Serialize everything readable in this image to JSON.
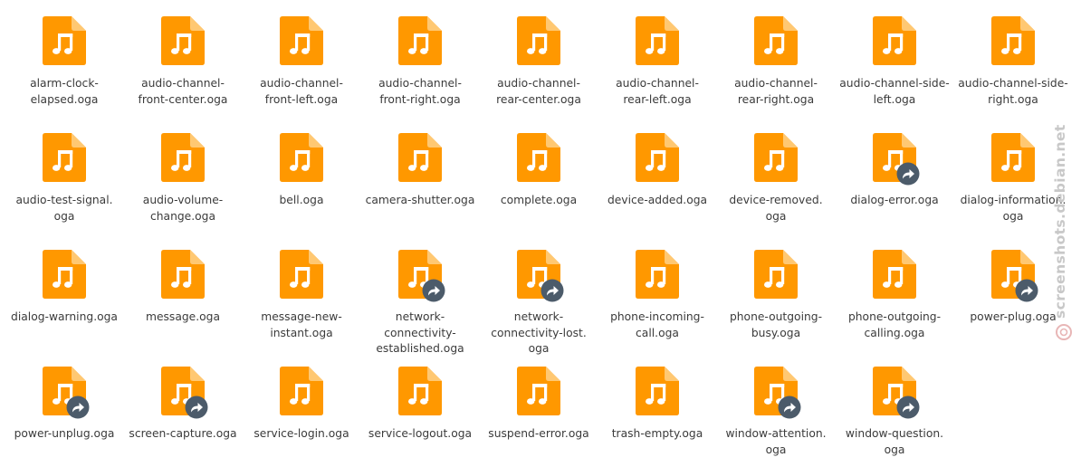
{
  "colors": {
    "file_body": "#ff9800",
    "file_fold": "#ffc872",
    "note_glyph": "#ffffff",
    "link_badge": "#4c5b6a",
    "label_text": "#3b3b3b",
    "watermark_text": "#c8c8c8",
    "watermark_logo": "#e8b6b6"
  },
  "watermark": {
    "text": "screenshots.debian.net",
    "logo_icon": "debian-swirl-icon"
  },
  "files": [
    {
      "name": "alarm-clock-elapsed.oga",
      "lines": [
        "alarm-clock-",
        "elapsed.oga"
      ],
      "icon": "audio-file-icon",
      "symlink": false
    },
    {
      "name": "audio-channel-front-center.oga",
      "lines": [
        "audio-channel-",
        "front-center.oga"
      ],
      "icon": "audio-file-icon",
      "symlink": false
    },
    {
      "name": "audio-channel-front-left.oga",
      "lines": [
        "audio-channel-",
        "front-left.oga"
      ],
      "icon": "audio-file-icon",
      "symlink": false
    },
    {
      "name": "audio-channel-front-right.oga",
      "lines": [
        "audio-channel-",
        "front-right.oga"
      ],
      "icon": "audio-file-icon",
      "symlink": false
    },
    {
      "name": "audio-channel-rear-center.oga",
      "lines": [
        "audio-channel-",
        "rear-center.oga"
      ],
      "icon": "audio-file-icon",
      "symlink": false
    },
    {
      "name": "audio-channel-rear-left.oga",
      "lines": [
        "audio-channel-",
        "rear-left.oga"
      ],
      "icon": "audio-file-icon",
      "symlink": false
    },
    {
      "name": "audio-channel-rear-right.oga",
      "lines": [
        "audio-channel-",
        "rear-right.oga"
      ],
      "icon": "audio-file-icon",
      "symlink": false
    },
    {
      "name": "audio-channel-side-left.oga",
      "lines": [
        "audio-channel-side-",
        "left.oga"
      ],
      "icon": "audio-file-icon",
      "symlink": false
    },
    {
      "name": "audio-channel-side-right.oga",
      "lines": [
        "audio-channel-side-",
        "right.oga"
      ],
      "icon": "audio-file-icon",
      "symlink": false
    },
    {
      "name": "audio-test-signal.oga",
      "lines": [
        "audio-test-signal.",
        "oga"
      ],
      "icon": "audio-file-icon",
      "symlink": false
    },
    {
      "name": "audio-volume-change.oga",
      "lines": [
        "audio-volume-",
        "change.oga"
      ],
      "icon": "audio-file-icon",
      "symlink": false
    },
    {
      "name": "bell.oga",
      "lines": [
        "bell.oga"
      ],
      "icon": "audio-file-icon",
      "symlink": false
    },
    {
      "name": "camera-shutter.oga",
      "lines": [
        "camera-shutter.oga"
      ],
      "icon": "audio-file-icon",
      "symlink": false
    },
    {
      "name": "complete.oga",
      "lines": [
        "complete.oga"
      ],
      "icon": "audio-file-icon",
      "symlink": false
    },
    {
      "name": "device-added.oga",
      "lines": [
        "device-added.oga"
      ],
      "icon": "audio-file-icon",
      "symlink": false
    },
    {
      "name": "device-removed.oga",
      "lines": [
        "device-removed.",
        "oga"
      ],
      "icon": "audio-file-icon",
      "symlink": false
    },
    {
      "name": "dialog-error.oga",
      "lines": [
        "dialog-error.oga"
      ],
      "icon": "audio-file-icon",
      "symlink": true
    },
    {
      "name": "dialog-information.oga",
      "lines": [
        "dialog-information.",
        "oga"
      ],
      "icon": "audio-file-icon",
      "symlink": false
    },
    {
      "name": "dialog-warning.oga",
      "lines": [
        "dialog-warning.oga"
      ],
      "icon": "audio-file-icon",
      "symlink": false
    },
    {
      "name": "message.oga",
      "lines": [
        "message.oga"
      ],
      "icon": "audio-file-icon",
      "symlink": false
    },
    {
      "name": "message-new-instant.oga",
      "lines": [
        "message-new-",
        "instant.oga"
      ],
      "icon": "audio-file-icon",
      "symlink": false
    },
    {
      "name": "network-connectivity-established.oga",
      "lines": [
        "network-",
        "connectivity-",
        "established.oga"
      ],
      "icon": "audio-file-icon",
      "symlink": true
    },
    {
      "name": "network-connectivity-lost.oga",
      "lines": [
        "network-",
        "connectivity-lost.",
        "oga"
      ],
      "icon": "audio-file-icon",
      "symlink": true
    },
    {
      "name": "phone-incoming-call.oga",
      "lines": [
        "phone-incoming-",
        "call.oga"
      ],
      "icon": "audio-file-icon",
      "symlink": false
    },
    {
      "name": "phone-outgoing-busy.oga",
      "lines": [
        "phone-outgoing-",
        "busy.oga"
      ],
      "icon": "audio-file-icon",
      "symlink": false
    },
    {
      "name": "phone-outgoing-calling.oga",
      "lines": [
        "phone-outgoing-",
        "calling.oga"
      ],
      "icon": "audio-file-icon",
      "symlink": false
    },
    {
      "name": "power-plug.oga",
      "lines": [
        "power-plug.oga"
      ],
      "icon": "audio-file-icon",
      "symlink": true
    },
    {
      "name": "power-unplug.oga",
      "lines": [
        "power-unplug.oga"
      ],
      "icon": "audio-file-icon",
      "symlink": true
    },
    {
      "name": "screen-capture.oga",
      "lines": [
        "screen-capture.oga"
      ],
      "icon": "audio-file-icon",
      "symlink": true
    },
    {
      "name": "service-login.oga",
      "lines": [
        "service-login.oga"
      ],
      "icon": "audio-file-icon",
      "symlink": false
    },
    {
      "name": "service-logout.oga",
      "lines": [
        "service-logout.oga"
      ],
      "icon": "audio-file-icon",
      "symlink": false
    },
    {
      "name": "suspend-error.oga",
      "lines": [
        "suspend-error.oga"
      ],
      "icon": "audio-file-icon",
      "symlink": false
    },
    {
      "name": "trash-empty.oga",
      "lines": [
        "trash-empty.oga"
      ],
      "icon": "audio-file-icon",
      "symlink": false
    },
    {
      "name": "window-attention.oga",
      "lines": [
        "window-attention.",
        "oga"
      ],
      "icon": "audio-file-icon",
      "symlink": true
    },
    {
      "name": "window-question.oga",
      "lines": [
        "window-question.",
        "oga"
      ],
      "icon": "audio-file-icon",
      "symlink": true
    }
  ]
}
